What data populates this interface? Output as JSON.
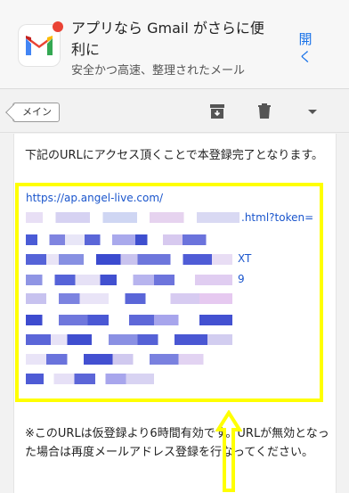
{
  "banner": {
    "title": "アプリなら Gmail がさらに便利に",
    "subtitle": "安全かつ高速、整理されたメール",
    "open_label": "開く"
  },
  "toolbar": {
    "label_chip": "メイン",
    "icons": [
      "archive-icon",
      "trash-icon",
      "dropdown-icon"
    ]
  },
  "email": {
    "intro": "下記のURLにアクセス頂くことで本登録完了となります。",
    "link_start": "https://ap.angel-live.com/",
    "link_fragment_1": ".html?token=",
    "link_fragment_2": "XT",
    "link_fragment_3": "9",
    "note": "※このURLは仮登録より6時間有効です。URLが無効となった場合は再度メールアドレス登録を行なってください。"
  },
  "colors": {
    "highlight": "#ffff00",
    "link": "#1a55cc",
    "accent": "#1a73e8"
  }
}
